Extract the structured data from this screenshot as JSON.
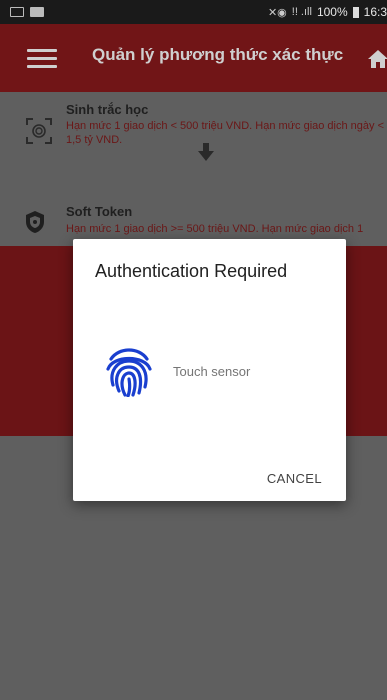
{
  "status_bar": {
    "signal_text": "!! .ıll",
    "battery": "100%",
    "time": "16:3"
  },
  "app_bar": {
    "title": "Quản lý phương thức xác thực"
  },
  "methods": [
    {
      "name": "Sinh trắc học",
      "description": "Hạn mức 1 giao dịch < 500 triệu VND. Hạn mức giao dịch ngày < 1,5 tỷ VND.",
      "icon": "fingerprint-scan-icon"
    },
    {
      "name": "Soft Token",
      "description": "Hạn mức 1 giao dịch >= 500 triệu VND. Hạn mức giao dịch 1",
      "icon": "shield-icon"
    }
  ],
  "dialog": {
    "title": "Authentication Required",
    "sensor_text": "Touch sensor",
    "cancel_label": "CANCEL"
  },
  "colors": {
    "brand_red": "#c8202a",
    "fingerprint_blue": "#1a3fcf"
  }
}
